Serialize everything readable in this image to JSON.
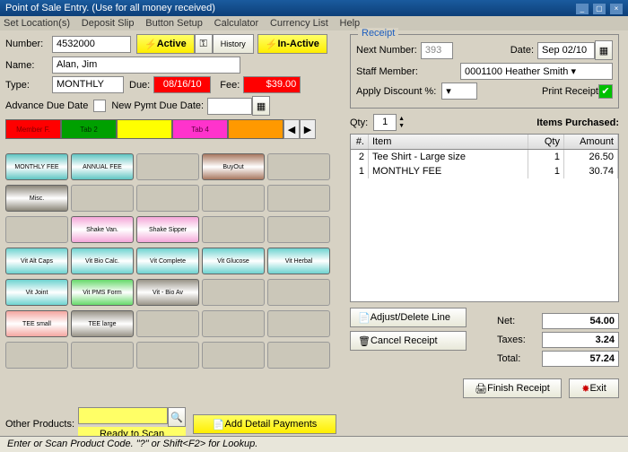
{
  "window": {
    "title": "Point of Sale Entry. (Use for all money received)"
  },
  "menu": [
    "Set Location(s)",
    "Deposit Slip",
    "Button Setup",
    "Calculator",
    "Currency List",
    "Help"
  ],
  "header": {
    "numberLabel": "Number:",
    "number": "4532000",
    "activeLabel": "Active",
    "historyLabel": "History",
    "inactiveLabel": "In-Active",
    "nameLabel": "Name:",
    "name": "Alan, Jim",
    "typeLabel": "Type:",
    "type": "MONTHLY",
    "dueLabel": "Due:",
    "due": "08/16/10",
    "feeLabel": "Fee:",
    "fee": "$39.00",
    "advanceLabel": "Advance Due Date",
    "newPymtLabel": "New Pymt Due Date:"
  },
  "tabs": [
    {
      "label": "Member F.",
      "bg": "#ff0000",
      "fg": "#800000"
    },
    {
      "label": "Tab 2",
      "bg": "#00a000",
      "fg": "#003000"
    },
    {
      "label": "",
      "bg": "#ffff00",
      "fg": "#000"
    },
    {
      "label": "Tab 4",
      "bg": "#ff33cc",
      "fg": "#600040"
    },
    {
      "label": "",
      "bg": "#ff9900",
      "fg": "#000"
    }
  ],
  "grid": [
    [
      {
        "t": "MONTHLY FEE",
        "c": "#5fc5c2"
      },
      {
        "t": "ANNUAL FEE",
        "c": "#5fc5c2"
      },
      null,
      {
        "t": "BuyOut",
        "c": "#a97860"
      },
      null
    ],
    [
      {
        "t": "Misc.",
        "c": "#8a8578"
      },
      null,
      null,
      null,
      null
    ],
    [
      null,
      {
        "t": "Shake Van.",
        "c": "#f4a6d8"
      },
      {
        "t": "Shake Sipper",
        "c": "#f4a6d8"
      },
      null,
      null
    ],
    [
      {
        "t": "Vit Alt Caps",
        "c": "#6ed3d0"
      },
      {
        "t": "Vit Bio Calc.",
        "c": "#6ed3d0"
      },
      {
        "t": "Vit Complete",
        "c": "#6ed3d0"
      },
      {
        "t": "Vit Glucose",
        "c": "#6ed3d0"
      },
      {
        "t": "Vit Herbal",
        "c": "#6ed3d0"
      }
    ],
    [
      {
        "t": "Vit Joint",
        "c": "#6ed3d0"
      },
      {
        "t": "Vit PMS Form",
        "c": "#66d96a"
      },
      {
        "t": "Vit - Bio Av",
        "c": "#999488"
      },
      null,
      null
    ],
    [
      {
        "t": "TEE small",
        "c": "#f4a6a0"
      },
      {
        "t": "TEE large",
        "c": "#999488"
      },
      null,
      null,
      null
    ],
    [
      null,
      null,
      null,
      null,
      null
    ]
  ],
  "otherProducts": {
    "label": "Other Products:",
    "ready": "Ready to Scan",
    "addDetail": "Add Detail Payments"
  },
  "receipt": {
    "legend": "Receipt",
    "nextLabel": "Next Number:",
    "nextVal": "393",
    "dateLabel": "Date:",
    "date": "Sep 02/10",
    "staffLabel": "Staff Member:",
    "staff": "0001100 Heather Smith",
    "discountLabel": "Apply Discount %:",
    "printLabel": "Print Receipt"
  },
  "items": {
    "qtyLabel": "Qty:",
    "qty": "1",
    "title": "Items Purchased:",
    "cols": {
      "num": "#.",
      "item": "Item",
      "qty": "Qty",
      "amt": "Amount"
    },
    "rows": [
      {
        "n": "2",
        "item": "Tee Shirt - Large size",
        "qty": "1",
        "amt": "26.50"
      },
      {
        "n": "1",
        "item": "MONTHLY FEE",
        "qty": "1",
        "amt": "30.74"
      }
    ]
  },
  "buttons": {
    "adjust": "Adjust/Delete Line",
    "cancel": "Cancel Receipt",
    "finish": "Finish Receipt",
    "exit": "Exit"
  },
  "totals": {
    "netL": "Net:",
    "net": "54.00",
    "taxL": "Taxes:",
    "tax": "3.24",
    "totL": "Total:",
    "tot": "57.24"
  },
  "status": "Enter or Scan Product Code. \"?\" or Shift<F2> for Lookup."
}
